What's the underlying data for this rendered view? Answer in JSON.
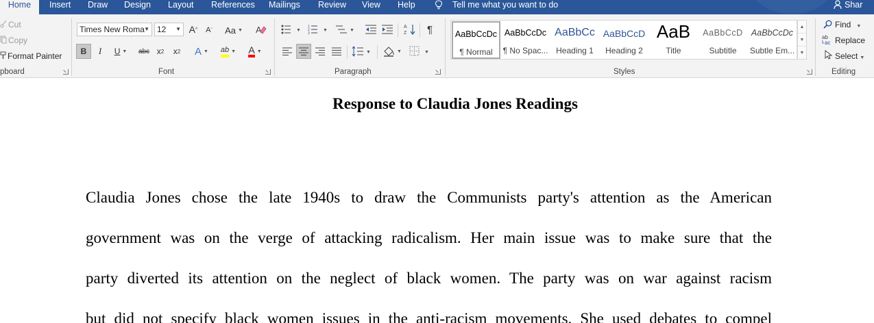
{
  "tabs": [
    {
      "label": "Home",
      "active": true
    },
    {
      "label": "Insert"
    },
    {
      "label": "Draw"
    },
    {
      "label": "Design"
    },
    {
      "label": "Layout"
    },
    {
      "label": "References"
    },
    {
      "label": "Mailings"
    },
    {
      "label": "Review"
    },
    {
      "label": "View"
    },
    {
      "label": "Help"
    }
  ],
  "tell_me": "Tell me what you want to do",
  "share": "Shar",
  "clipboard": {
    "cut": "Cut",
    "copy": "Copy",
    "format_painter": "Format Painter",
    "group_label": "pboard"
  },
  "font": {
    "name": "Times New Roma",
    "size": "12",
    "grow": "A",
    "shrink": "A",
    "change_case": "Aa",
    "bold": "B",
    "italic": "I",
    "underline": "U",
    "strike": "abc",
    "subscript": "x",
    "superscript": "x",
    "text_effects": "A",
    "highlight": "ab",
    "font_color": "A",
    "group_label": "Font",
    "highlight_color": "#ffff00",
    "font_color_value": "#ff0000"
  },
  "paragraph": {
    "group_label": "Paragraph"
  },
  "styles": {
    "group_label": "Styles",
    "items": [
      {
        "preview": "AaBbCcDc",
        "name": "¶ Normal",
        "selected": true
      },
      {
        "preview": "AaBbCcDc",
        "name": "¶ No Spac..."
      },
      {
        "preview": "AaBbCc",
        "name": "Heading 1"
      },
      {
        "preview": "AaBbCcD",
        "name": "Heading 2"
      },
      {
        "preview": "AaB",
        "name": "Title"
      },
      {
        "preview": "AaBbCcD",
        "name": "Subtitle"
      },
      {
        "preview": "AaBbCcDc",
        "name": "Subtle Em..."
      }
    ]
  },
  "editing": {
    "find": "Find",
    "replace": "Replace",
    "select": "Select",
    "group_label": "Editing"
  },
  "document": {
    "title": "Response to Claudia Jones Readings",
    "lines": [
      "Claudia Jones chose the late 1940s to draw the Communists party's attention as the American",
      "government was on the verge of attacking radicalism. Her main issue was to make sure that the",
      "party diverted its attention on the neglect of black women. The party was on war against racism",
      "but did not specify black women issues in the anti-racism movements. She used debates to compel"
    ]
  },
  "colors": {
    "accent": "#2b579a",
    "ribbon_bg": "#f3f3f3"
  }
}
